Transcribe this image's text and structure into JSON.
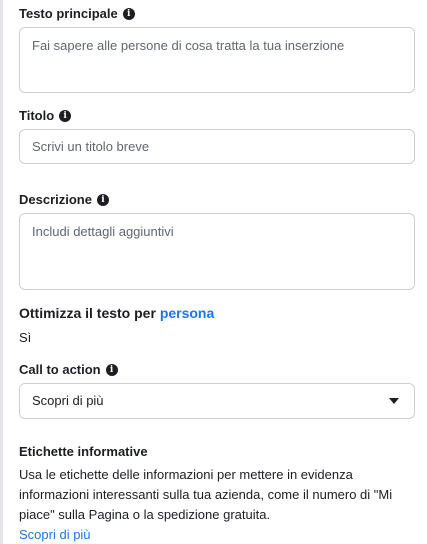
{
  "main_text": {
    "label": "Testo principale",
    "placeholder": "Fai sapere alle persone di cosa tratta la tua inserzione"
  },
  "title_field": {
    "label": "Titolo",
    "placeholder": "Scrivi un titolo breve"
  },
  "description": {
    "label": "Descrizione",
    "placeholder": "Includi dettagli aggiuntivi"
  },
  "optimize": {
    "prefix": "Ottimizza il testo per ",
    "link": "persona",
    "value": "Sì"
  },
  "call_to_action": {
    "label": "Call to action",
    "selected": "Scopri di più"
  },
  "info_labels": {
    "title": "Etichette informative",
    "description": "Usa le etichette delle informazioni per mettere in evidenza informazioni interessanti sulla tua azienda, come il numero di \"Mi piace\" sulla Pagina o la spedizione gratuita.",
    "learn_more": "Scopri di più"
  },
  "icons": {
    "info": "info-circle-icon",
    "dropdown": "caret-down-icon"
  },
  "colors": {
    "link": "#1877f2",
    "border": "#ccd0d5",
    "text": "#1c1e21",
    "placeholder": "#606770"
  }
}
